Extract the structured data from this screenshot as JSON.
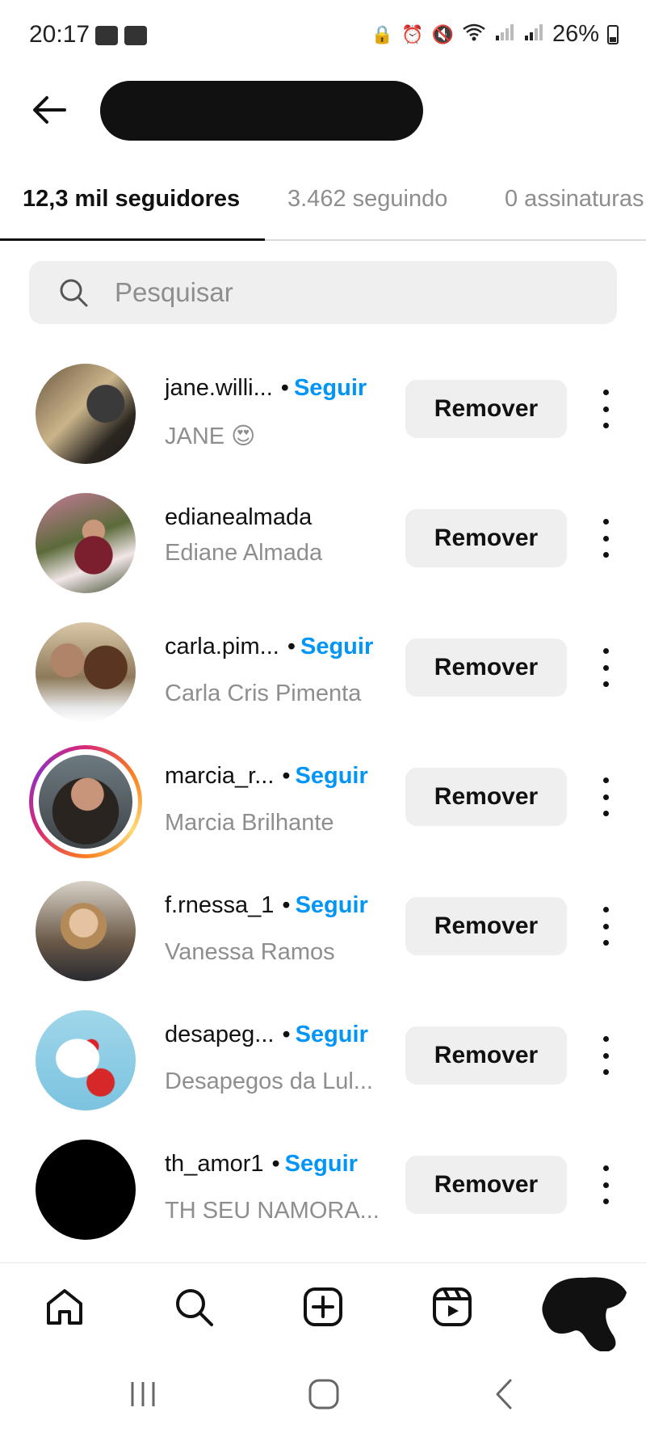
{
  "status_bar": {
    "time": "20:17",
    "battery": "26%"
  },
  "header": {
    "title": ""
  },
  "tabs": [
    {
      "label": "12,3 mil seguidores"
    },
    {
      "label": "3.462 seguindo"
    },
    {
      "label": "0 assinaturas"
    }
  ],
  "search": {
    "placeholder": "Pesquisar"
  },
  "followers": [
    {
      "username": "jane.willi...",
      "follow": "Seguir",
      "name": "JANE 😍",
      "remove": "Remover"
    },
    {
      "username": "edianealmada",
      "follow": "",
      "name": "Ediane Almada",
      "remove": "Remover"
    },
    {
      "username": "carla.pim...",
      "follow": "Seguir",
      "name": "Carla Cris Pimenta",
      "remove": "Remover"
    },
    {
      "username": "marcia_r...",
      "follow": "Seguir",
      "name": "Marcia Brilhante",
      "remove": "Remover"
    },
    {
      "username": "f.rnessa_1",
      "follow": "Seguir",
      "name": "Vanessa Ramos",
      "remove": "Remover"
    },
    {
      "username": "desapeg...",
      "follow": "Seguir",
      "name": "Desapegos da Lul...",
      "remove": "Remover"
    },
    {
      "username": "th_amor1",
      "follow": "Seguir",
      "name": "TH SEU NAMORA...",
      "remove": "Remover"
    }
  ],
  "icons": {
    "back": "arrow-left-icon",
    "search": "search-icon",
    "more": "more-vertical-icon",
    "nav": [
      "home-icon",
      "search-icon",
      "create-post-icon",
      "reels-icon",
      "profile-icon"
    ],
    "system": [
      "recent-apps-icon",
      "home-button-icon",
      "back-button-icon"
    ]
  },
  "colors": {
    "link": "#0095f6",
    "button_bg": "#efefef",
    "muted": "#8e8e8e"
  }
}
